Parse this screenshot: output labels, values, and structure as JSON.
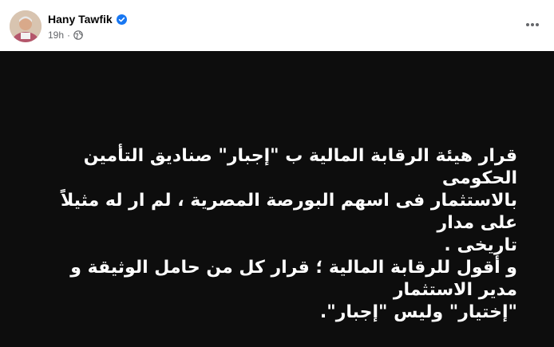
{
  "post": {
    "author_name": "Hany Tawfik",
    "timestamp": "19h",
    "separator": "·",
    "privacy_icon": "globe-icon",
    "verified_icon": "verified-badge-icon",
    "more_icon": "more-horizontal-icon",
    "accent_color": "#1877f2",
    "background_color": "#0d0d0d",
    "text_color": "#ffffff",
    "lines": [
      "قرار هيئة الرقابة المالية ب \"إجبار\" صناديق التأمين الحكومى",
      "بالاستثمار فى اسهم البورصة المصرية ، لم ار له مثيلاً على مدار",
      "تاريخى .",
      "و أقول للرقابة المالية ؛ قرار كل من حامل الوثيقة و مدير الاستثمار",
      "\"إختيار\" وليس \"إجبار\"."
    ]
  }
}
